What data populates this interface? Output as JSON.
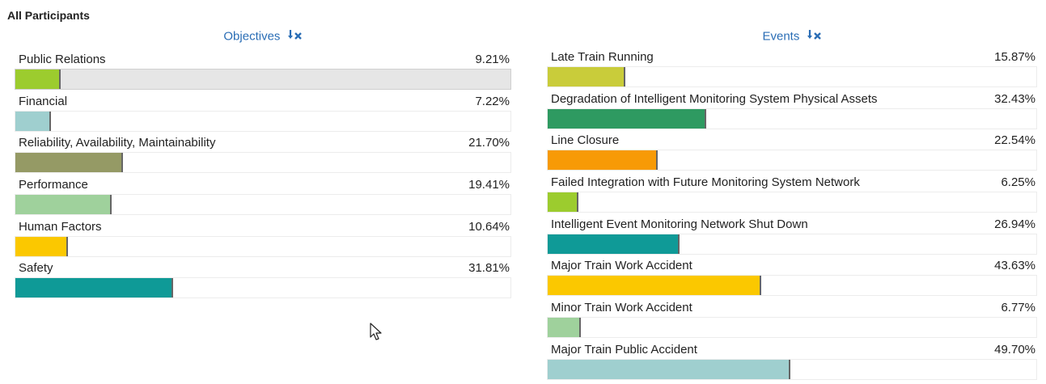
{
  "page_title": "All Participants",
  "objectives": {
    "header": "Objectives",
    "rows": [
      {
        "label": "Public Relations",
        "value": "9.21%",
        "pct": 9.21,
        "color": "#9ccc2e",
        "selected": true
      },
      {
        "label": "Financial",
        "value": "7.22%",
        "pct": 7.22,
        "color": "#9fcfcf"
      },
      {
        "label": "Reliability, Availability, Maintainability",
        "value": "21.70%",
        "pct": 21.7,
        "color": "#959a65"
      },
      {
        "label": "Performance",
        "value": "19.41%",
        "pct": 19.41,
        "color": "#9fd19c"
      },
      {
        "label": "Human Factors",
        "value": "10.64%",
        "pct": 10.64,
        "color": "#fbc800"
      },
      {
        "label": "Safety",
        "value": "31.81%",
        "pct": 31.81,
        "color": "#0f9a97"
      }
    ]
  },
  "events": {
    "header": "Events",
    "rows": [
      {
        "label": "Late Train Running",
        "value": "15.87%",
        "pct": 15.87,
        "color": "#c9cc3a"
      },
      {
        "label": "Degradation of Intelligent Monitoring System Physical Assets",
        "value": "32.43%",
        "pct": 32.43,
        "color": "#2e9a61"
      },
      {
        "label": "Line Closure",
        "value": "22.54%",
        "pct": 22.54,
        "color": "#f79a06"
      },
      {
        "label": "Failed Integration with Future Monitoring System Network",
        "value": "6.25%",
        "pct": 6.25,
        "color": "#9ccc2e"
      },
      {
        "label": "Intelligent Event Monitoring Network Shut Down",
        "value": "26.94%",
        "pct": 26.94,
        "color": "#0f9a97"
      },
      {
        "label": "Major Train Work Accident",
        "value": "43.63%",
        "pct": 43.63,
        "color": "#fbc800"
      },
      {
        "label": "Minor Train Work Accident",
        "value": "6.77%",
        "pct": 6.77,
        "color": "#9fd19c"
      },
      {
        "label": "Major Train Public Accident",
        "value": "49.70%",
        "pct": 49.7,
        "color": "#9fcfcf"
      }
    ]
  },
  "icons": {
    "sort_clear": "sort-clear-icon",
    "cursor": "mouse-pointer-icon"
  }
}
